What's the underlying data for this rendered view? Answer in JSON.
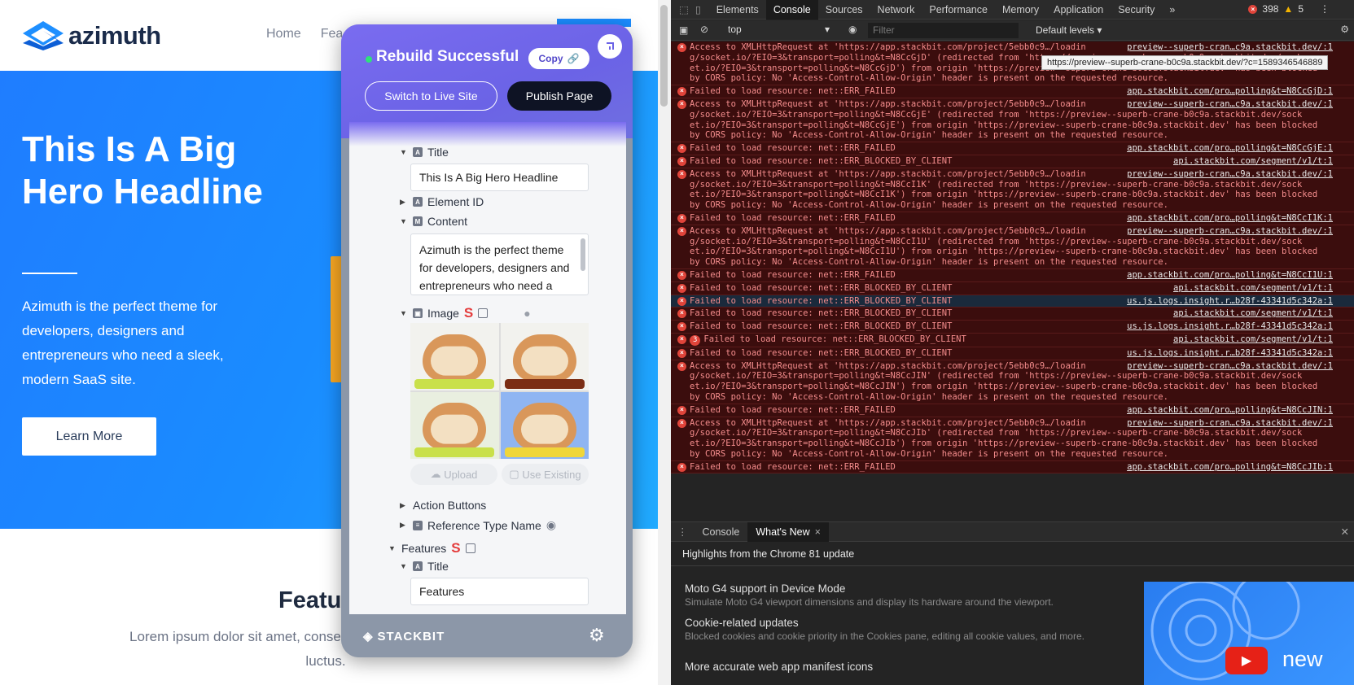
{
  "site": {
    "logo_text": "azimuth",
    "nav": [
      "Home",
      "Fea"
    ],
    "hero_title": "This Is A Big Hero Headline",
    "hero_text": "Azimuth is the perfect theme for developers, designers and entrepreneurs who need a sleek, modern SaaS site.",
    "hero_button": "Learn More",
    "features_title": "Featu",
    "features_text": "Lorem ipsum dolor sit amet, conse metus quis lorem malesuada luctus."
  },
  "panel": {
    "status": "Rebuild Successful",
    "copy_label": "Copy",
    "live_button": "Switch to Live Site",
    "publish_button": "Publish Page",
    "fields": {
      "title_label": "Title",
      "title_value": "This Is A Big Hero Headline",
      "element_id_label": "Element ID",
      "content_label": "Content",
      "content_value": "Azimuth is the perfect theme for developers, designers and entrepreneurs who need a",
      "image_label": "Image",
      "upload_label": "Upload",
      "use_existing_label": "Use Existing",
      "action_buttons_label": "Action Buttons",
      "reference_type_label": "Reference Type Name",
      "features_label": "Features",
      "features_title_label": "Title",
      "features_title_value": "Features"
    },
    "footer_logo": "STACKBIT"
  },
  "devtools": {
    "tabs": [
      "Elements",
      "Console",
      "Sources",
      "Network",
      "Performance",
      "Memory",
      "Application",
      "Security"
    ],
    "active_tab": "Console",
    "error_count": "398",
    "warning_count": "5",
    "context": "top",
    "filter_placeholder": "Filter",
    "levels": "Default levels",
    "tooltip": "https://preview--superb-crane-b0c9a.stackbit.dev/?c=1589346546889",
    "messages": [
      {
        "text": "Access to XMLHttpRequest at 'https://app.stackbit.com/project/5ebb0c9…/loadin g/socket.io/?EIO=3&transport=polling&t=N8CcGjD' (redirected from 'https://preview--superb-crane-b0c9a.stackbit.dev/sock et.io/?EIO=3&transport=polling&t=N8CcGjD') from origin 'https://preview--superb-crane-b0c9a.stackbit.dev' has been blocked by CORS policy: No 'Access-Control-Allow-Origin' header is present on the requested resource.",
        "source": "preview--superb-cran…c9a.stackbit.dev/:1"
      },
      {
        "text": "Failed to load resource: net::ERR_FAILED",
        "source": "app.stackbit.com/pro…polling&t=N8CcGjD:1"
      },
      {
        "text": "Access to XMLHttpRequest at 'https://app.stackbit.com/project/5ebb0c9…/loadin g/socket.io/?EIO=3&transport=polling&t=N8CcGjE' (redirected from 'https://preview--superb-crane-b0c9a.stackbit.dev/sock et.io/?EIO=3&transport=polling&t=N8CcGjE') from origin 'https://preview--superb-crane-b0c9a.stackbit.dev' has been blocked by CORS policy: No 'Access-Control-Allow-Origin' header is present on the requested resource.",
        "source": "preview--superb-cran…c9a.stackbit.dev/:1"
      },
      {
        "text": "Failed to load resource: net::ERR_FAILED",
        "source": "app.stackbit.com/pro…polling&t=N8CcGjE:1"
      },
      {
        "text": "Failed to load resource: net::ERR_BLOCKED_BY_CLIENT",
        "source": "api.stackbit.com/segment/v1/t:1"
      },
      {
        "text": "Access to XMLHttpRequest at 'https://app.stackbit.com/project/5ebb0c9…/loadin g/socket.io/?EIO=3&transport=polling&t=N8CcI1K' (redirected from 'https://preview--superb-crane-b0c9a.stackbit.dev/sock et.io/?EIO=3&transport=polling&t=N8CcI1K') from origin 'https://preview--superb-crane-b0c9a.stackbit.dev' has been blocked by CORS policy: No 'Access-Control-Allow-Origin' header is present on the requested resource.",
        "source": "preview--superb-cran…c9a.stackbit.dev/:1"
      },
      {
        "text": "Failed to load resource: net::ERR_FAILED",
        "source": "app.stackbit.com/pro…polling&t=N8CcI1K:1"
      },
      {
        "text": "Access to XMLHttpRequest at 'https://app.stackbit.com/project/5ebb0c9…/loadin g/socket.io/?EIO=3&transport=polling&t=N8CcI1U' (redirected from 'https://preview--superb-crane-b0c9a.stackbit.dev/sock et.io/?EIO=3&transport=polling&t=N8CcI1U') from origin 'https://preview--superb-crane-b0c9a.stackbit.dev' has been blocked by CORS policy: No 'Access-Control-Allow-Origin' header is present on the requested resource.",
        "source": "preview--superb-cran…c9a.stackbit.dev/:1"
      },
      {
        "text": "Failed to load resource: net::ERR_FAILED",
        "source": "app.stackbit.com/pro…polling&t=N8CcI1U:1"
      },
      {
        "text": "Failed to load resource: net::ERR_BLOCKED_BY_CLIENT",
        "source": "api.stackbit.com/segment/v1/t:1"
      },
      {
        "text": "Failed to load resource: net::ERR_BLOCKED_BY_CLIENT",
        "source": "us.js.logs.insight.r…b28f-43341d5c342a:1",
        "selected": true
      },
      {
        "text": "Failed to load resource: net::ERR_BLOCKED_BY_CLIENT",
        "source": "api.stackbit.com/segment/v1/t:1"
      },
      {
        "text": "Failed to load resource: net::ERR_BLOCKED_BY_CLIENT",
        "source": "us.js.logs.insight.r…b28f-43341d5c342a:1"
      },
      {
        "text": "Failed to load resource: net::ERR_BLOCKED_BY_CLIENT",
        "source": "api.stackbit.com/segment/v1/t:1",
        "count": "3"
      },
      {
        "text": "Failed to load resource: net::ERR_BLOCKED_BY_CLIENT",
        "source": "us.js.logs.insight.r…b28f-43341d5c342a:1"
      },
      {
        "text": "Access to XMLHttpRequest at 'https://app.stackbit.com/project/5ebb0c9…/loadin g/socket.io/?EIO=3&transport=polling&t=N8CcJIN' (redirected from 'https://preview--superb-crane-b0c9a.stackbit.dev/sock et.io/?EIO=3&transport=polling&t=N8CcJIN') from origin 'https://preview--superb-crane-b0c9a.stackbit.dev' has been blocked by CORS policy: No 'Access-Control-Allow-Origin' header is present on the requested resource.",
        "source": "preview--superb-cran…c9a.stackbit.dev/:1"
      },
      {
        "text": "Failed to load resource: net::ERR_FAILED",
        "source": "app.stackbit.com/pro…polling&t=N8CcJIN:1"
      },
      {
        "text": "Access to XMLHttpRequest at 'https://app.stackbit.com/project/5ebb0c9…/loadin g/socket.io/?EIO=3&transport=polling&t=N8CcJIb' (redirected from 'https://preview--superb-crane-b0c9a.stackbit.dev/sock et.io/?EIO=3&transport=polling&t=N8CcJIb') from origin 'https://preview--superb-crane-b0c9a.stackbit.dev' has been blocked by CORS policy: No 'Access-Control-Allow-Origin' header is present on the requested resource.",
        "source": "preview--superb-cran…c9a.stackbit.dev/:1"
      },
      {
        "text": "Failed to load resource: net::ERR_FAILED",
        "source": "app.stackbit.com/pro…polling&t=N8CcJIb:1"
      }
    ],
    "drawer_tabs": [
      "Console",
      "What's New"
    ],
    "drawer_active": "What's New",
    "whats_new_heading": "Highlights from the Chrome 81 update",
    "whats_new_items": [
      {
        "title": "Moto G4 support in Device Mode",
        "desc": "Simulate Moto G4 viewport dimensions and display its hardware around the viewport."
      },
      {
        "title": "Cookie-related updates",
        "desc": "Blocked cookies and cookie priority in the Cookies pane, editing all cookie values, and more."
      },
      {
        "title": "More accurate web app manifest icons",
        "desc": ""
      }
    ],
    "video_label": "new"
  }
}
